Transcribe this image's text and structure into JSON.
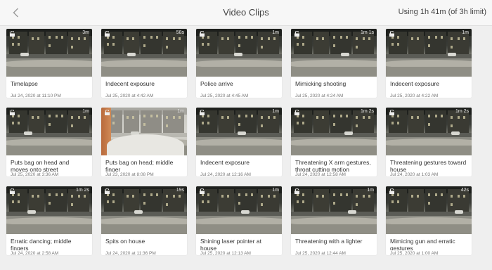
{
  "header": {
    "back_icon": "chevron-left-icon",
    "title": "Video Clips",
    "usage": "Using 1h 41m (of 3h limit)"
  },
  "clips": [
    {
      "label": "Timelapse",
      "date": "Jul 24, 2020 at 11:10 PM",
      "duration": "3m",
      "variant": "normal"
    },
    {
      "label": "Indecent exposure",
      "date": "Jul 25, 2020 at 4:42 AM",
      "duration": "58s",
      "variant": "normal"
    },
    {
      "label": "Police arrive",
      "date": "Jul 25, 2020 at 4:45 AM",
      "duration": "1m",
      "variant": "normal"
    },
    {
      "label": "Mimicking shooting",
      "date": "Jul 25, 2020 at 4:24 AM",
      "duration": "1m 1s",
      "variant": "normal"
    },
    {
      "label": "Indecent exposure",
      "date": "Jul 25, 2020 at 4:22 AM",
      "duration": "1m",
      "variant": "normal"
    },
    {
      "label": "Puts bag on head and moves onto street",
      "date": "Jul 25, 2020 at 3:36 AM",
      "duration": "1m",
      "variant": "normal"
    },
    {
      "label": "Puts bag on head; middle finger",
      "date": "Jul 23, 2020 at 8:08 PM",
      "duration": "1m",
      "variant": "bright"
    },
    {
      "label": "Indecent exposure",
      "date": "Jul 24, 2020 at 12:16 AM",
      "duration": "1m",
      "variant": "normal"
    },
    {
      "label": "Threatening X arm gestures, throat cutting motion",
      "date": "Jul 24, 2020 at 12:58 AM",
      "duration": "1m 2s",
      "variant": "normal"
    },
    {
      "label": "Threatening gestures toward house",
      "date": "Jul 24, 2020 at 1:03 AM",
      "duration": "1m 2s",
      "variant": "normal"
    },
    {
      "label": "Erratic dancing; middle fingers",
      "date": "Jul 24, 2020 at 2:58 AM",
      "duration": "1m 2s",
      "variant": "normal"
    },
    {
      "label": "Spits on house",
      "date": "Jul 24, 2020 at 11:36 PM",
      "duration": "19s",
      "variant": "normal"
    },
    {
      "label": "Shining laser pointer at house",
      "date": "Jul 25, 2020 at 12:13 AM",
      "duration": "1m",
      "variant": "normal"
    },
    {
      "label": "Threatening with a lighter",
      "date": "Jul 25, 2020 at 12:44 AM",
      "duration": "1m",
      "variant": "normal"
    },
    {
      "label": "Mimicing gun and erratic gestures",
      "date": "Jul 25, 2020 at 1:00 AM",
      "duration": "42s",
      "variant": "normal"
    }
  ],
  "icons": {
    "lock": "lock-icon"
  },
  "colors": {
    "background": "#efefef",
    "header": "#f7f7f7",
    "card": "#ffffff"
  }
}
